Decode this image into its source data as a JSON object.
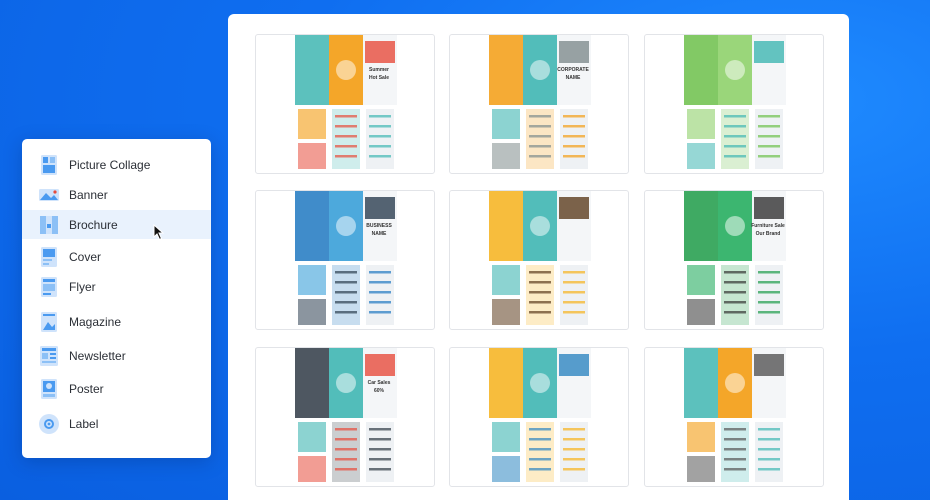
{
  "menu": {
    "items": [
      {
        "label": "Picture Collage",
        "icon": "picture-collage-icon"
      },
      {
        "label": "Banner",
        "icon": "banner-icon"
      },
      {
        "label": "Brochure",
        "icon": "brochure-icon",
        "active": true
      },
      {
        "label": "Cover",
        "icon": "cover-icon"
      },
      {
        "label": "Flyer",
        "icon": "flyer-icon"
      },
      {
        "label": "Magazine",
        "icon": "magazine-icon"
      },
      {
        "label": "Newsletter",
        "icon": "newsletter-icon"
      },
      {
        "label": "Poster",
        "icon": "poster-icon"
      },
      {
        "label": "Label",
        "icon": "label-icon"
      }
    ]
  },
  "templates": [
    {
      "name": "food-brochure",
      "text": [
        "Summer",
        "Hot Sale"
      ],
      "colors": [
        "#3fb6b2",
        "#f39c12",
        "#e74c3c"
      ]
    },
    {
      "name": "corporate-brochure",
      "text": [
        "CORPORATE",
        "NAME"
      ],
      "colors": [
        "#f39c12",
        "#3fb6b2",
        "#7f8c8d"
      ]
    },
    {
      "name": "christmas-brochure",
      "text": [],
      "colors": [
        "#6cc04a",
        "#8fd16b",
        "#3fb6b2"
      ]
    },
    {
      "name": "business-brochure",
      "text": [
        "BUSINESS",
        "NAME"
      ],
      "colors": [
        "#1f78c1",
        "#3aa0d8",
        "#2c3e50"
      ]
    },
    {
      "name": "travel-brochure",
      "text": [],
      "colors": [
        "#f6b21b",
        "#3fb6b2",
        "#5c3d1e"
      ]
    },
    {
      "name": "furniture-brochure",
      "text": [
        "Furniture Sale",
        "Our Brand"
      ],
      "colors": [
        "#1d9b48",
        "#27ae60",
        "#333333"
      ]
    },
    {
      "name": "car-brochure",
      "text": [
        "Car Sales",
        "60%"
      ],
      "colors": [
        "#2f3a45",
        "#3fb6b2",
        "#e74c3c"
      ]
    },
    {
      "name": "beach-brochure",
      "text": [],
      "colors": [
        "#f6b21b",
        "#3fb6b2",
        "#2e86c1"
      ]
    },
    {
      "name": "city-tour-brochure",
      "text": [],
      "colors": [
        "#3fb6b2",
        "#f39c12",
        "#555555"
      ]
    }
  ]
}
